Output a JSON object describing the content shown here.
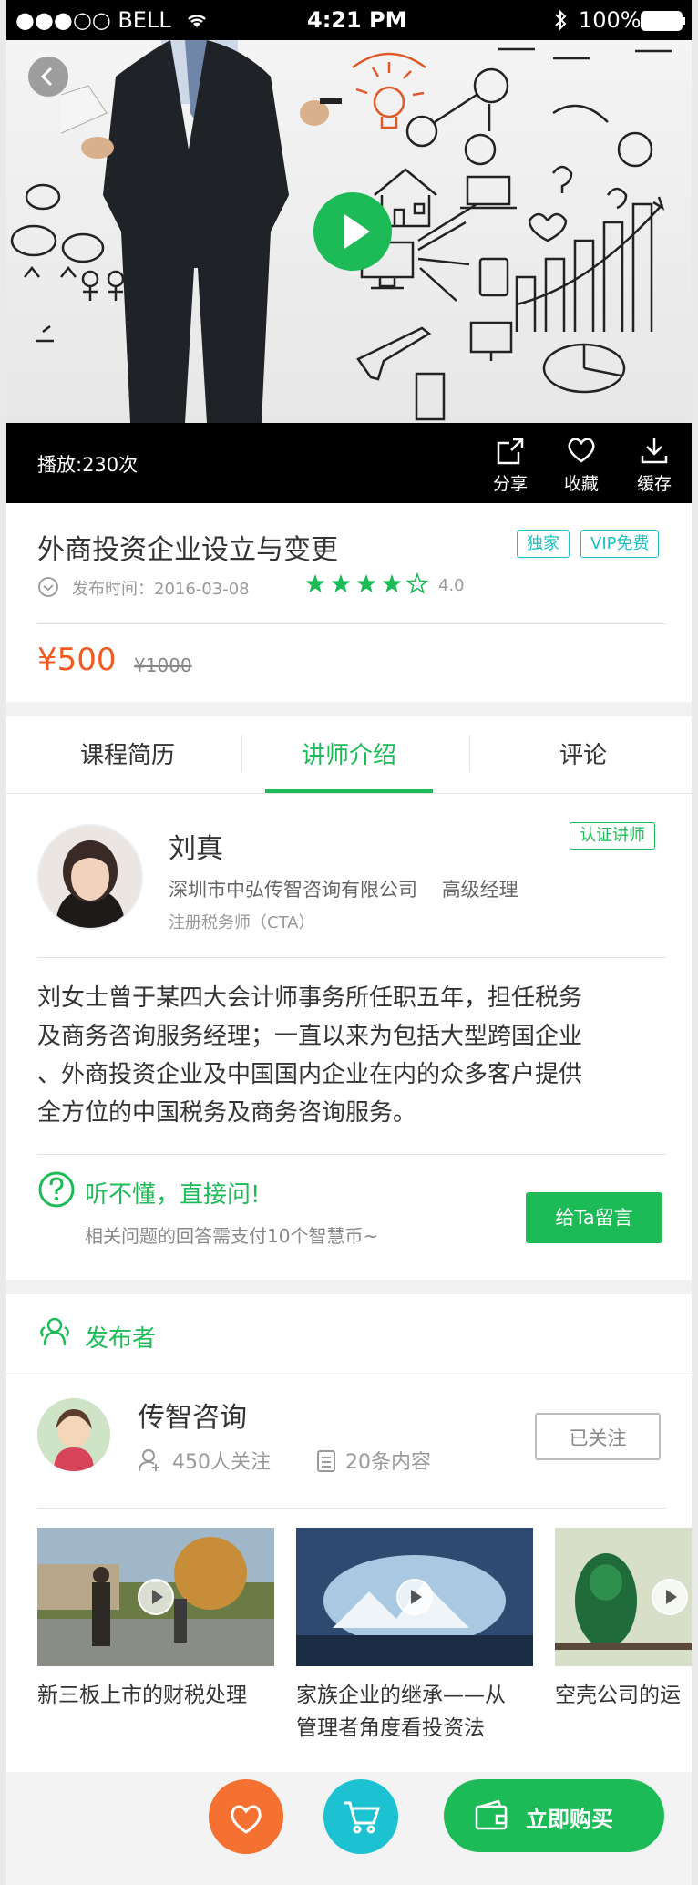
{
  "status_bar": {
    "carrier": "●●●○○ BELL",
    "time": "4:21 PM",
    "battery": "100%"
  },
  "video": {
    "play_count": "播放:230次"
  },
  "actions": {
    "share": "分享",
    "favorite": "收藏",
    "download": "缓存"
  },
  "course": {
    "title": "外商投资企业设立与变更",
    "tags": [
      "独家",
      "VIP免费"
    ],
    "publish_label": "发布时间：2016-03-08",
    "rating": "4.0",
    "rating_stars": 4,
    "rating_max": 5,
    "price": "¥500",
    "original_price": "¥1000"
  },
  "tabs": [
    "课程简历",
    "讲师介绍",
    "评论"
  ],
  "active_tab": "讲师介绍",
  "lecturer": {
    "name": "刘真",
    "badge": "认证讲师",
    "company": "深圳市中弘传智咨询有限公司",
    "position": "高级经理",
    "certification": "注册税务师（CTA）",
    "bio_lines": [
      "刘女士曾于某四大会计师事务所任职五年，担任税务",
      "及商务咨询服务经理；一直以来为包括大型跨国企业",
      "、外商投资企业及中国国内企业在内的众多客户提供",
      "全方位的中国税务及商务咨询服务。"
    ]
  },
  "ask": {
    "title": "听不懂，直接问!",
    "subtitle": "相关问题的回答需支付10个智慧币~",
    "button": "给Ta留言"
  },
  "publisher": {
    "section_title": "发布者",
    "name": "传智咨询",
    "followers": "450人关注",
    "contents": "20条内容",
    "follow_button": "已关注"
  },
  "related_videos": [
    {
      "title_lines": [
        "新三板上市的财税处理"
      ]
    },
    {
      "title_lines": [
        "家族企业的继承——从",
        "管理者角度看投资法"
      ]
    },
    {
      "title_lines": [
        "空壳公司的运"
      ]
    }
  ],
  "bottom": {
    "buy_button": "立即购买"
  },
  "colors": {
    "green": "#1dbb57",
    "orange": "#f47131",
    "cyan": "#1cc1c4",
    "price": "#f15a22"
  }
}
